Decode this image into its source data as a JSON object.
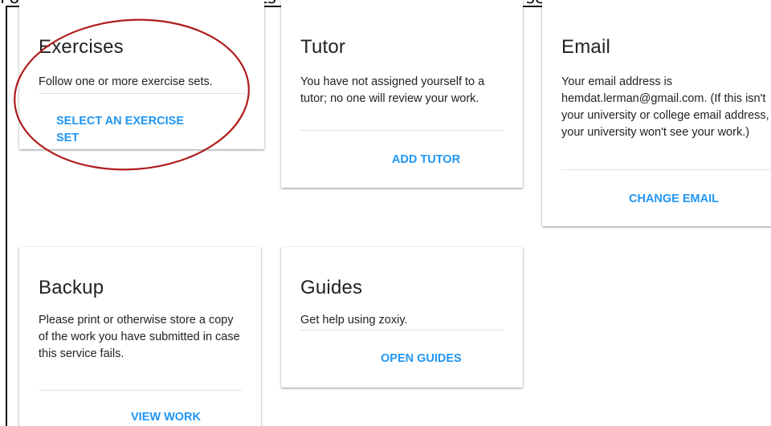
{
  "instruction": "Follow one or more exercise sets : Click on 'select an exercise set'",
  "cards": {
    "exercises": {
      "title": "Exercises",
      "text": "Follow one or more exercise sets.",
      "action": "SELECT AN EXERCISE SET"
    },
    "tutor": {
      "title": "Tutor",
      "text": "You have not assigned yourself to a tutor; no one will review your work.",
      "action": "ADD TUTOR"
    },
    "email": {
      "title": "Email",
      "text": "Your email address is hemdat.lerman@gmail.com. (If this isn't your university or college email address, your university won't see your work.)",
      "action": "CHANGE EMAIL"
    },
    "backup": {
      "title": "Backup",
      "text": "Please print or otherwise store a copy of the work you have submitted in case this service fails.",
      "action": "VIEW WORK"
    },
    "guides": {
      "title": "Guides",
      "text": "Get help using zoxiy.",
      "action": "OPEN GUIDES"
    }
  },
  "colors": {
    "action": "#2196f3",
    "annotation": "#b01c1c",
    "text": "#222222"
  }
}
